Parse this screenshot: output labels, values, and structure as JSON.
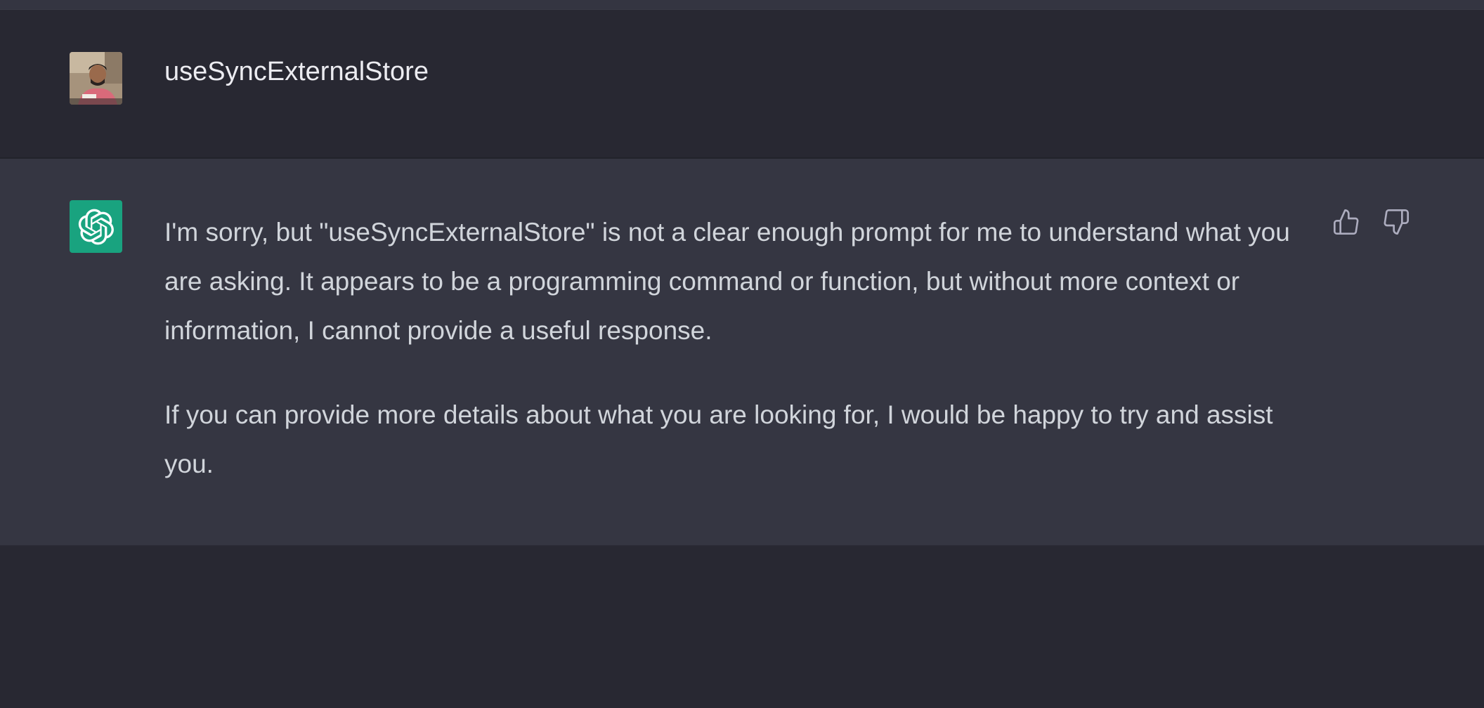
{
  "colors": {
    "background": "#282832",
    "assistant_row": "#353642",
    "accent_green": "#19a37f",
    "text_primary": "#ececf1",
    "text_secondary": "#d1d5db"
  },
  "user_message": {
    "avatar": "user-avatar-photo",
    "text": "useSyncExternalStore"
  },
  "assistant_message": {
    "avatar": "openai-logo-icon",
    "paragraphs": [
      "I'm sorry, but \"useSyncExternalStore\" is not a clear enough prompt for me to understand what you are asking. It appears to be a programming command or function, but without more context or information, I cannot provide a useful response.",
      "If you can provide more details about what you are looking for, I would be happy to try and assist you."
    ],
    "actions": {
      "like_icon": "thumbs-up-icon",
      "dislike_icon": "thumbs-down-icon"
    }
  }
}
